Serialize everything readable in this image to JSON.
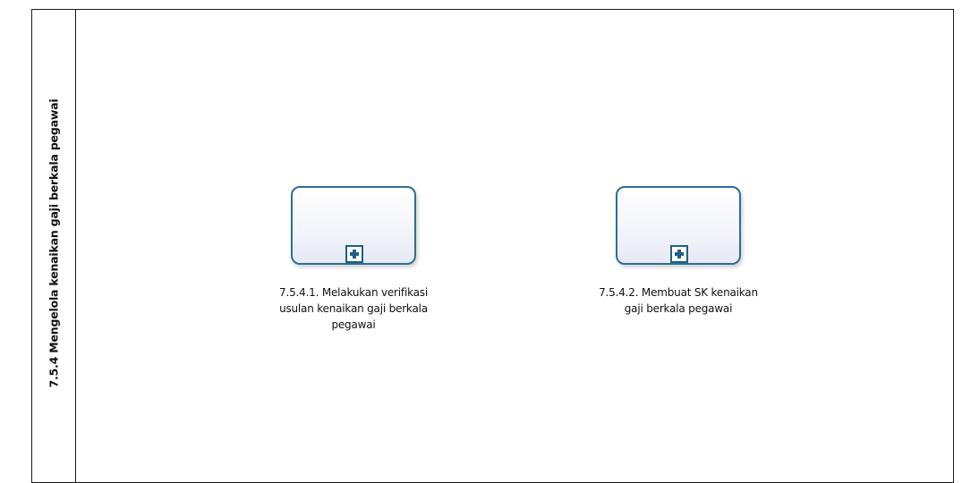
{
  "lane": {
    "title": "7.5.4 Mengelola kenaikan gaji berkala pegawai"
  },
  "tasks": [
    {
      "label_line1": "7.5.4.1. Melakukan verifikasi",
      "label_line2": "usulan kenaikan gaji berkala",
      "label_line3": "pegawai",
      "marker": "subprocess-plus-icon"
    },
    {
      "label_line1": "7.5.4.2. Membuat SK kenaikan",
      "label_line2": "gaji berkala pegawai",
      "marker": "subprocess-plus-icon"
    }
  ],
  "colors": {
    "task_border": "#2d6e95",
    "task_fill": "#f4f5fb",
    "lines": "#1a1a1a"
  }
}
